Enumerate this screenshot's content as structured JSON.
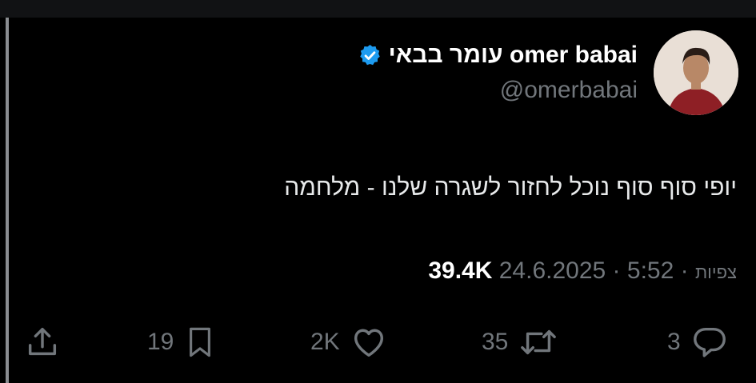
{
  "author": {
    "display_name": "עומר בבאי omer babai",
    "handle": "@omerbabai",
    "verified": true
  },
  "tweet": {
    "text": "יופי סוף סוף נוכל לחזור לשגרה שלנו - מלחמה",
    "date": "24.6.2025",
    "time": "5:52",
    "views_count": "39.4K",
    "views_label": "צפיות"
  },
  "actions": {
    "replies": "3",
    "retweets": "35",
    "likes": "2K",
    "bookmarks": "19"
  },
  "colors": {
    "background": "#000000",
    "text": "#e7e9ea",
    "secondary": "#71767b",
    "verified_badge": "#1d9bf0"
  },
  "icons": [
    "verified-badge-icon",
    "reply-icon",
    "retweet-icon",
    "like-icon",
    "bookmark-icon",
    "share-icon"
  ]
}
